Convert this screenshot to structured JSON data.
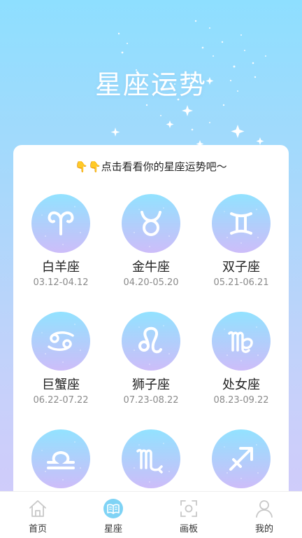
{
  "header": {
    "title": "星座运势"
  },
  "card": {
    "hint": "👇👇点击看看你的星座运势吧～",
    "signs": [
      {
        "name": "白羊座",
        "dates": "03.12-04.12",
        "icon": "aries-icon"
      },
      {
        "name": "金牛座",
        "dates": "04.20-05.20",
        "icon": "taurus-icon"
      },
      {
        "name": "双子座",
        "dates": "05.21-06.21",
        "icon": "gemini-icon"
      },
      {
        "name": "巨蟹座",
        "dates": "06.22-07.22",
        "icon": "cancer-icon"
      },
      {
        "name": "狮子座",
        "dates": "07.23-08.22",
        "icon": "leo-icon"
      },
      {
        "name": "处女座",
        "dates": "08.23-09.22",
        "icon": "virgo-icon"
      },
      {
        "name": "",
        "dates": "",
        "icon": "libra-icon"
      },
      {
        "name": "",
        "dates": "",
        "icon": "scorpio-icon"
      },
      {
        "name": "",
        "dates": "",
        "icon": "sagittarius-icon"
      }
    ]
  },
  "tabbar": {
    "items": [
      {
        "label": "首页",
        "icon": "home-icon",
        "active": false
      },
      {
        "label": "星座",
        "icon": "book-icon",
        "active": true
      },
      {
        "label": "画板",
        "icon": "scan-frame-icon",
        "active": false
      },
      {
        "label": "我的",
        "icon": "user-icon",
        "active": false
      }
    ]
  },
  "colors": {
    "background_top": "#8edfff",
    "background_bottom": "#d3c9fb",
    "circle_top": "#92e2ff",
    "circle_bottom": "#cdbdf9",
    "active_tab": "#7fd3f5"
  }
}
